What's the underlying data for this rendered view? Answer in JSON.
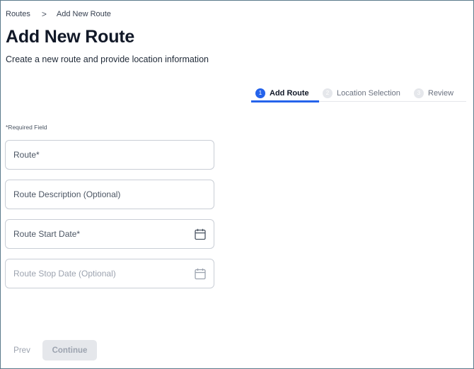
{
  "breadcrumb": {
    "items": [
      {
        "label": "Routes"
      },
      {
        "label": "Add New Route"
      }
    ],
    "separator": ">"
  },
  "header": {
    "title": "Add New Route",
    "subtitle": "Create a new route and provide location information"
  },
  "stepper": {
    "steps": [
      {
        "number": "1",
        "label": "Add Route",
        "state": "active"
      },
      {
        "number": "2",
        "label": "Location Selection",
        "state": "inactive"
      },
      {
        "number": "3",
        "label": "Review",
        "state": "inactive"
      }
    ]
  },
  "form": {
    "required_note": "*Required Field",
    "fields": [
      {
        "label": "Route*",
        "icon": null
      },
      {
        "label": "Route Description (Optional)",
        "icon": null
      },
      {
        "label": "Route Start Date*",
        "icon": "calendar-icon"
      },
      {
        "label": "Route Stop Date (Optional)",
        "icon": "calendar-icon",
        "disabled": true
      }
    ]
  },
  "footer": {
    "prev_label": "Prev",
    "continue_label": "Continue"
  },
  "colors": {
    "accent": "#2563eb",
    "border": "#c9ced6",
    "disabled_bg": "#e5e7eb",
    "disabled_text": "#9ca3af"
  }
}
